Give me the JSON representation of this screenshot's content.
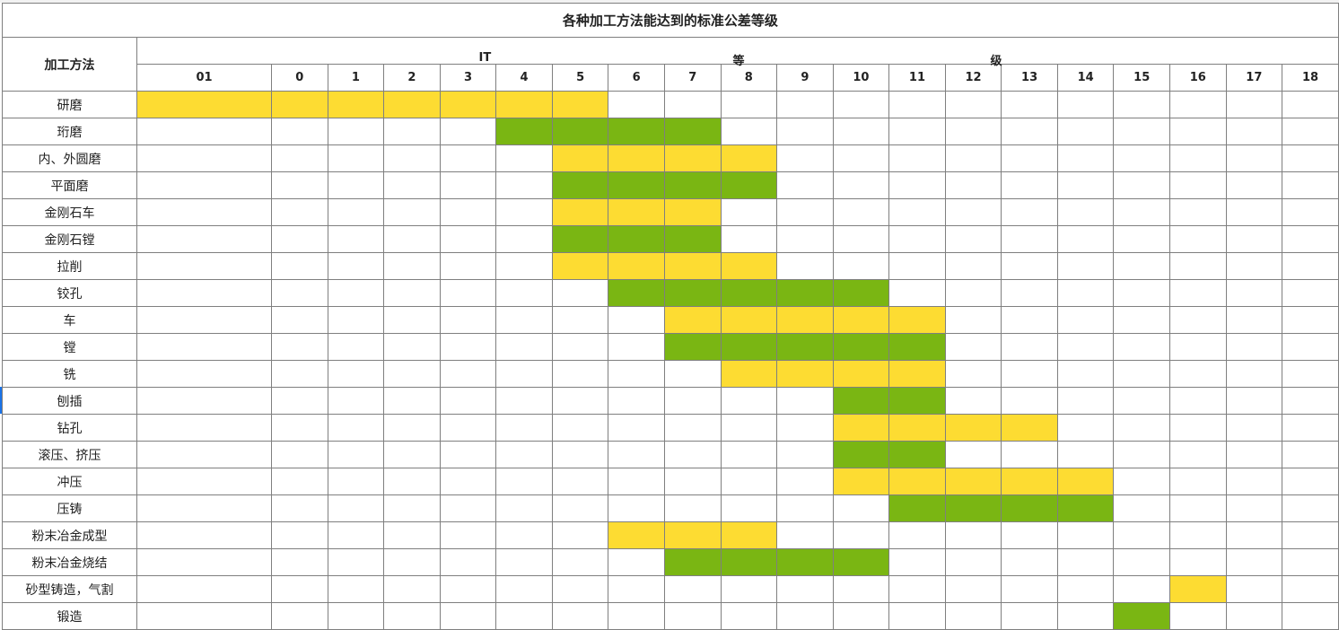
{
  "title": "各种加工方法能达到的标准公差等级",
  "method_header": "加工方法",
  "grade_header_parts": [
    "IT",
    "等",
    "级"
  ],
  "grades": [
    "01",
    "0",
    "1",
    "2",
    "3",
    "4",
    "5",
    "6",
    "7",
    "8",
    "9",
    "10",
    "11",
    "12",
    "13",
    "14",
    "15",
    "16",
    "17",
    "18"
  ],
  "colors": {
    "yellow": "#fddc32",
    "green": "#7ab613",
    "border": "#7f7f7f"
  },
  "rows": [
    {
      "method": "研磨",
      "color": "yellow",
      "from": "01",
      "to": "5"
    },
    {
      "method": "珩磨",
      "color": "green",
      "from": "4",
      "to": "7"
    },
    {
      "method": "内、外圆磨",
      "color": "yellow",
      "from": "5",
      "to": "8"
    },
    {
      "method": "平面磨",
      "color": "green",
      "from": "5",
      "to": "8"
    },
    {
      "method": "金刚石车",
      "color": "yellow",
      "from": "5",
      "to": "7"
    },
    {
      "method": "金刚石镗",
      "color": "green",
      "from": "5",
      "to": "7"
    },
    {
      "method": "拉削",
      "color": "yellow",
      "from": "5",
      "to": "8"
    },
    {
      "method": "铰孔",
      "color": "green",
      "from": "6",
      "to": "10"
    },
    {
      "method": "车",
      "color": "yellow",
      "from": "7",
      "to": "11"
    },
    {
      "method": "镗",
      "color": "green",
      "from": "7",
      "to": "11"
    },
    {
      "method": "铣",
      "color": "yellow",
      "from": "8",
      "to": "11"
    },
    {
      "method": "刨插",
      "color": "green",
      "from": "10",
      "to": "11"
    },
    {
      "method": "钻孔",
      "color": "yellow",
      "from": "10",
      "to": "13"
    },
    {
      "method": "滚压、挤压",
      "color": "green",
      "from": "10",
      "to": "11"
    },
    {
      "method": "冲压",
      "color": "yellow",
      "from": "10",
      "to": "14"
    },
    {
      "method": "压铸",
      "color": "green",
      "from": "11",
      "to": "14"
    },
    {
      "method": "粉末冶金成型",
      "color": "yellow",
      "from": "6",
      "to": "8"
    },
    {
      "method": "粉末冶金烧结",
      "color": "green",
      "from": "7",
      "to": "10"
    },
    {
      "method": "砂型铸造，气割",
      "color": "yellow",
      "from": "16",
      "to": "16"
    },
    {
      "method": "锻造",
      "color": "green",
      "from": "15",
      "to": "15"
    }
  ]
}
